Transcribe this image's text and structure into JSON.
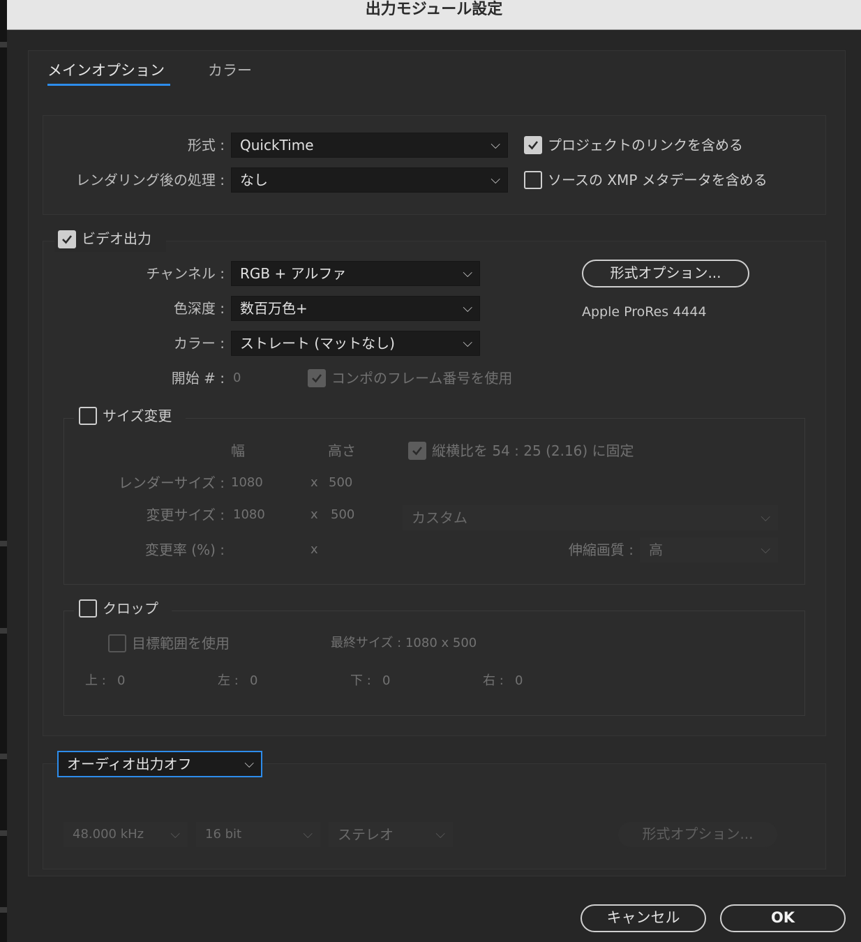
{
  "window": {
    "title": "出力モジュール設定"
  },
  "tabs": [
    {
      "label": "メインオプション",
      "active": true
    },
    {
      "label": "カラー",
      "active": false
    }
  ],
  "format_section": {
    "format_label": "形式 :",
    "format_value": "QuickTime",
    "post_render_label": "レンダリング後の処理 :",
    "post_render_value": "なし",
    "include_project_link": {
      "label": "プロジェクトのリンクを含める",
      "checked": true
    },
    "include_xmp": {
      "label": "ソースの XMP メタデータを含める",
      "checked": false
    }
  },
  "video_output": {
    "label": "ビデオ出力",
    "checked": true,
    "channels_label": "チャンネル :",
    "channels_value": "RGB + アルファ",
    "depth_label": "色深度 :",
    "depth_value": "数百万色+",
    "color_label": "カラー :",
    "color_value": "ストレート (マットなし)",
    "start_label": "開始 # :",
    "start_value": "0",
    "use_comp_frame": {
      "label": "コンポのフレーム番号を使用",
      "checked": true
    },
    "format_options_button": "形式オプション...",
    "codec_info": "Apple ProRes 4444"
  },
  "resize": {
    "label": "サイズ変更",
    "checked": false,
    "width_header": "幅",
    "height_header": "高さ",
    "lock_aspect": {
      "label": "縦横比を 54 : 25 (2.16) に固定",
      "checked": true
    },
    "render_size_label": "レンダーサイズ :",
    "render_w": "1080",
    "render_h": "500",
    "resize_to_label": "変更サイズ :",
    "resize_w": "1080",
    "resize_h": "500",
    "x_sep": "x",
    "preset_value": "カスタム",
    "resize_pct_label": "変更率 (%) :",
    "quality_label": "伸縮画質 :",
    "quality_value": "高"
  },
  "crop": {
    "label": "クロップ",
    "checked": false,
    "use_roi": {
      "label": "目標範囲を使用",
      "checked": false
    },
    "final_size": "最終サイズ : 1080 x 500",
    "top_label": "上 :",
    "top_value": "0",
    "left_label": "左 :",
    "left_value": "0",
    "bottom_label": "下 :",
    "bottom_value": "0",
    "right_label": "右 :",
    "right_value": "0"
  },
  "audio": {
    "mode_value": "オーディオ出力オフ",
    "sample_rate": "48.000 kHz",
    "bit_depth": "16 bit",
    "channels": "ステレオ",
    "format_options_button": "形式オプション..."
  },
  "footer": {
    "cancel": "キャンセル",
    "ok": "OK"
  },
  "colors": {
    "accent": "#2d8ceb",
    "background": "#262626",
    "panel": "#2c2c2c"
  }
}
